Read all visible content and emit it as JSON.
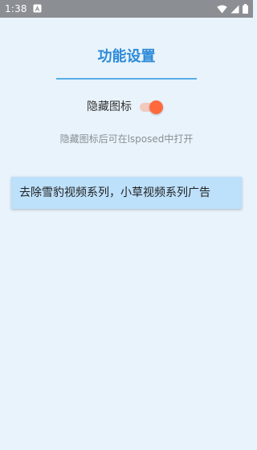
{
  "status_bar": {
    "time": "1:38",
    "icons": [
      "notification-icon",
      "wifi-icon",
      "signal-icon",
      "battery-icon"
    ]
  },
  "page": {
    "title": "功能设置",
    "toggle": {
      "label": "隐藏图标",
      "state": "on"
    },
    "hint": "隐藏图标后可在lsposed中打开",
    "card": {
      "text": "去除雪豹视频系列，小草视频系列广告"
    }
  },
  "colors": {
    "accent": "#2c8ad8",
    "switch_thumb": "#ff6a3d",
    "card_bg": "#bde0fb",
    "page_bg": "#e8f3fb"
  }
}
